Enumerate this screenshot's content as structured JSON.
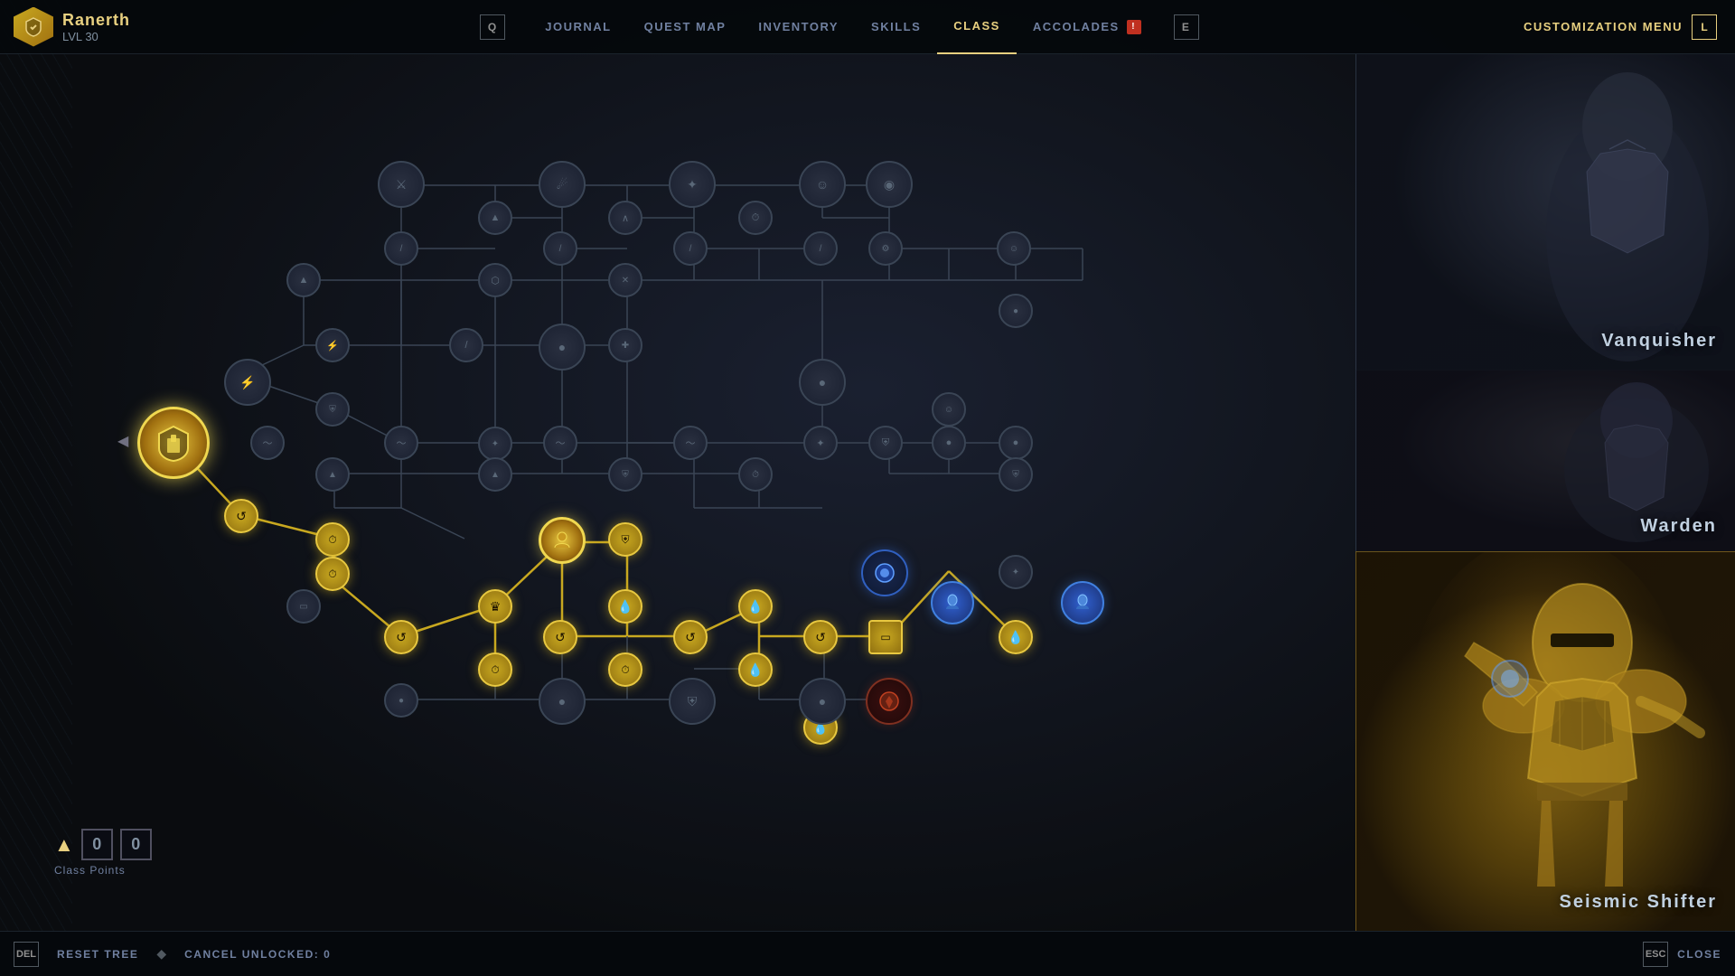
{
  "player": {
    "name": "Ranerth",
    "level_label": "LVL",
    "level": "30"
  },
  "nav": {
    "key_q": "Q",
    "key_e": "E",
    "key_l": "L",
    "items": [
      {
        "id": "journal",
        "label": "JOURNAL",
        "active": false
      },
      {
        "id": "quest-map",
        "label": "QUEST MAP",
        "active": false
      },
      {
        "id": "inventory",
        "label": "INVENTORY",
        "active": false
      },
      {
        "id": "skills",
        "label": "SKILLS",
        "active": false
      },
      {
        "id": "class",
        "label": "CLASS",
        "active": true
      },
      {
        "id": "accolades",
        "label": "ACCOLADES",
        "active": false,
        "badge": "!"
      }
    ],
    "customization_label": "CUSTOMIZATION MENU"
  },
  "classes": {
    "vanquisher": {
      "label": "Vanquisher"
    },
    "warden": {
      "label": "Warden"
    },
    "seismic_shifter": {
      "label": "Seismic Shifter"
    }
  },
  "class_points": {
    "label": "Class Points",
    "val1": "0",
    "val2": "0"
  },
  "bottom_bar": {
    "key_del": "DEL",
    "key_esc": "ESC",
    "reset_tree": "RESET TREE",
    "cancel_unlocked": "CANCEL UNLOCKED: 0",
    "close": "CLOSE"
  }
}
